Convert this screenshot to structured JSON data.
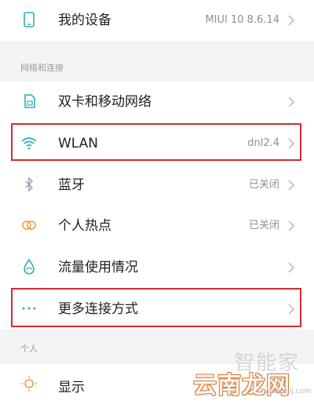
{
  "colors": {
    "accent_teal": "#2bb0b7",
    "highlight_red": "#d8292f",
    "secondary_text": "#8f8f8f"
  },
  "rows": {
    "my_device": {
      "label": "我的设备",
      "value": "MIUI 10 8.6.14",
      "icon": "phone-icon"
    },
    "dual_sim": {
      "label": "双卡和移动网络",
      "icon": "sim-card-icon"
    },
    "wlan": {
      "label": "WLAN",
      "value": "dnl2.4",
      "icon": "wifi-icon"
    },
    "bluetooth": {
      "label": "蓝牙",
      "value": "已关闭",
      "icon": "bluetooth-icon"
    },
    "hotspot": {
      "label": "个人热点",
      "value": "已关闭",
      "icon": "hotspot-icon"
    },
    "data_usage": {
      "label": "流量使用情况",
      "icon": "data-drop-icon"
    },
    "more_connections": {
      "label": "更多连接方式",
      "icon": "more-dots-icon"
    },
    "display": {
      "label": "显示",
      "icon": "sun-icon"
    }
  },
  "sections": {
    "network": "网络和连接",
    "personal": "个人"
  },
  "watermark": {
    "line1": "智能家",
    "line2": "云南龙网",
    "line3": "www.znj.com"
  }
}
